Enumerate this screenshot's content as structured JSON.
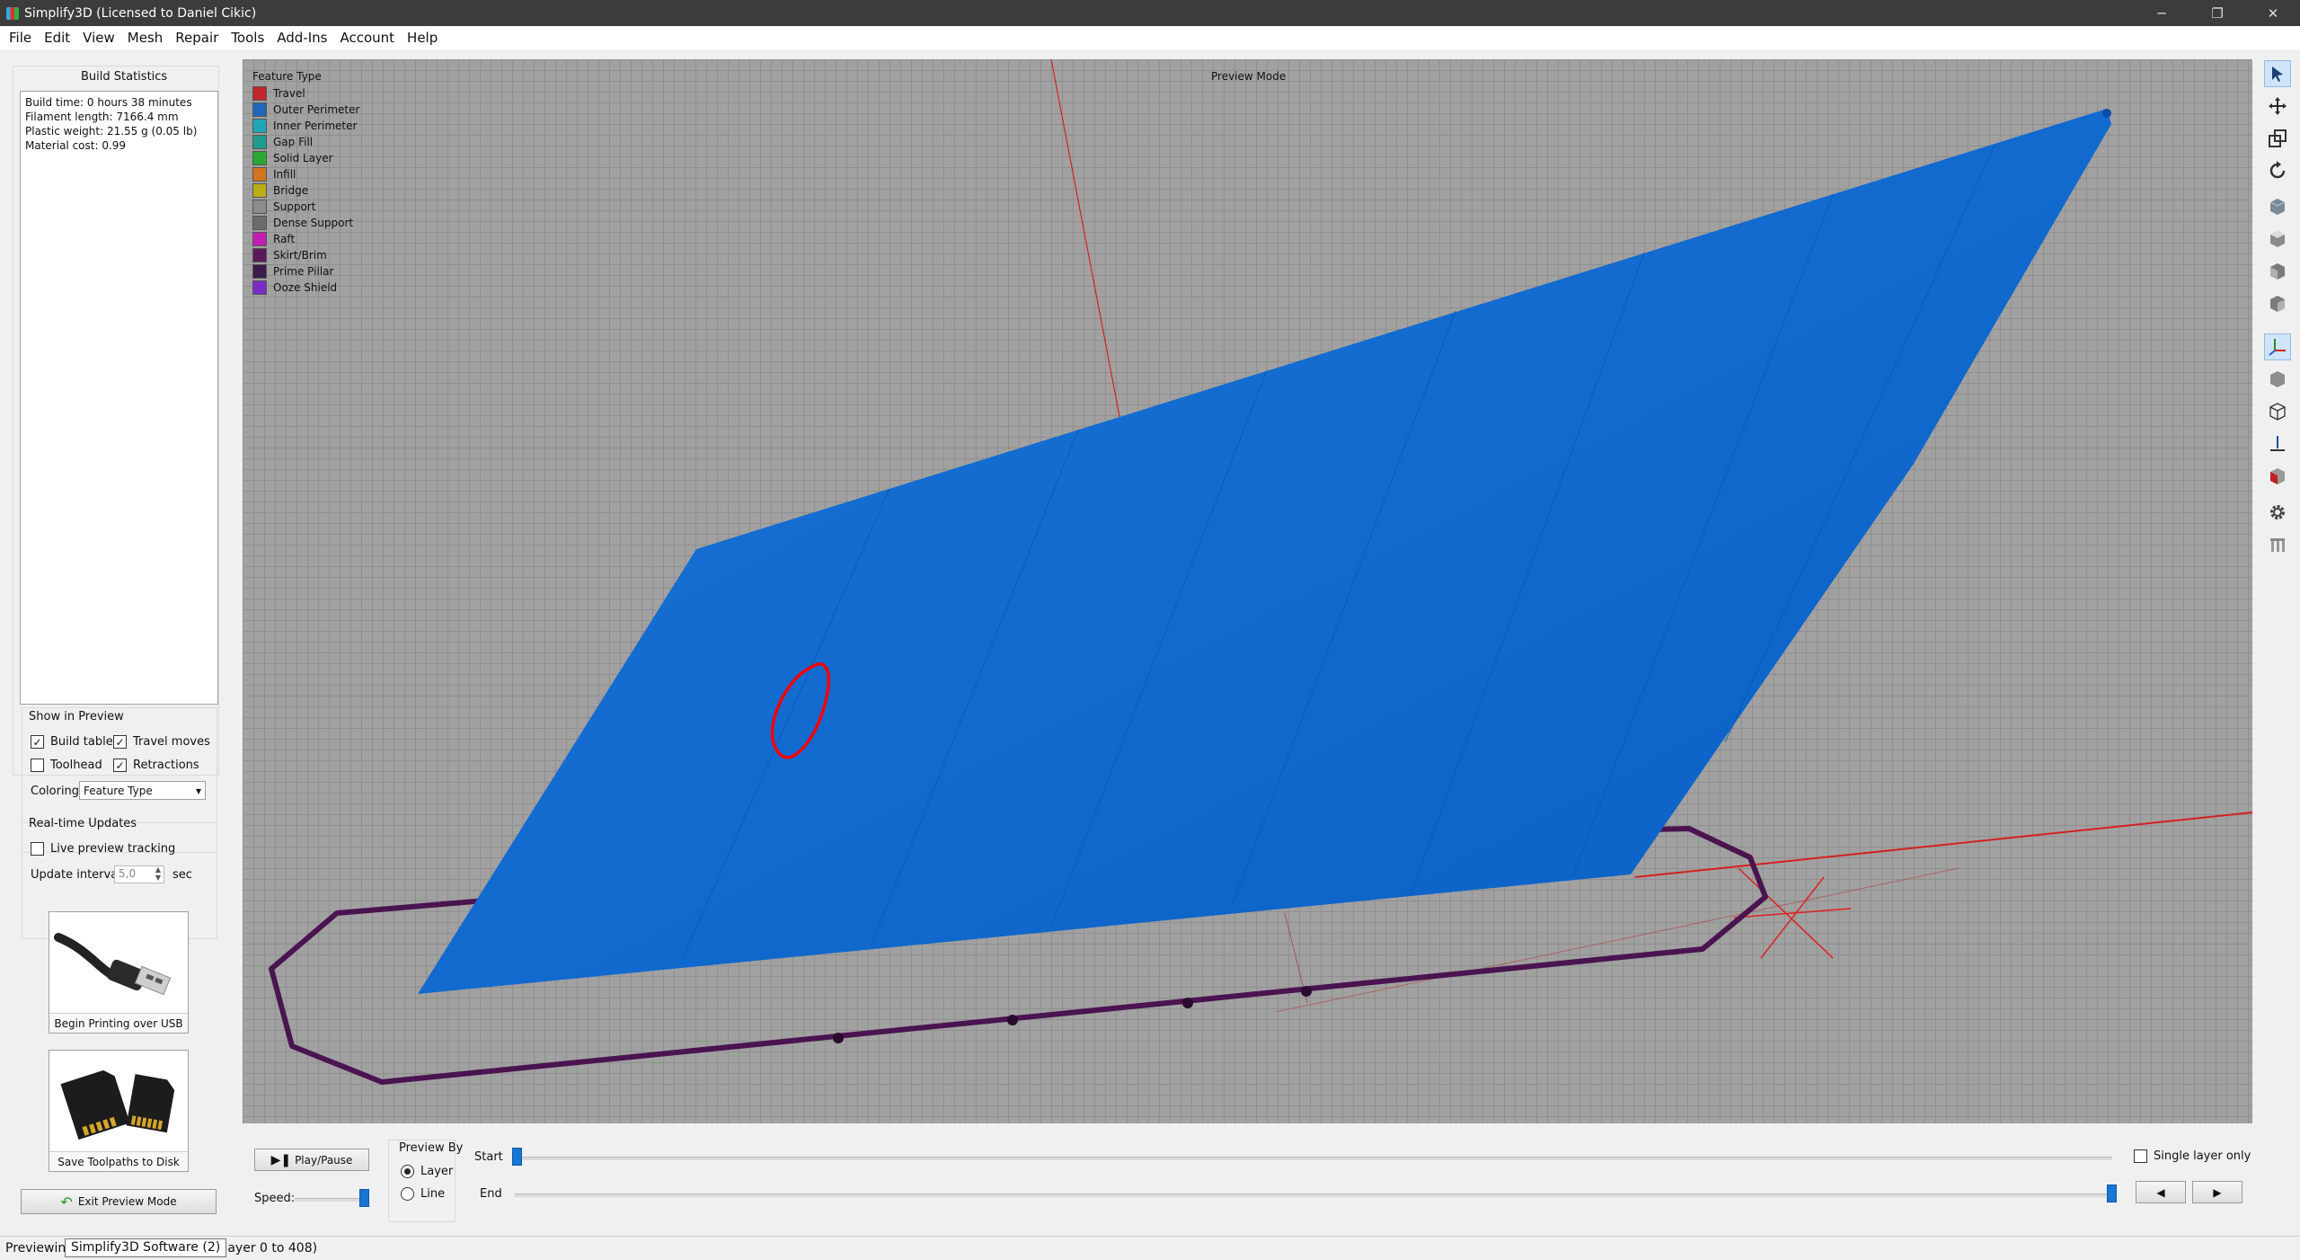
{
  "window": {
    "title": "Simplify3D (Licensed to Daniel Cikic)",
    "minimize": "─",
    "restore": "❐",
    "close": "✕"
  },
  "menu": [
    "File",
    "Edit",
    "View",
    "Mesh",
    "Repair",
    "Tools",
    "Add-Ins",
    "Account",
    "Help"
  ],
  "build_statistics": {
    "title": "Build Statistics",
    "lines": [
      "Build time: 0 hours 38 minutes",
      "Filament length: 7166.4 mm",
      "Plastic weight: 21.55 g (0.05 lb)",
      "Material cost: 0.99"
    ]
  },
  "show_in_preview": {
    "title": "Show in Preview",
    "build_table": {
      "label": "Build table",
      "checked": true
    },
    "travel_moves": {
      "label": "Travel moves",
      "checked": true
    },
    "toolhead": {
      "label": "Toolhead",
      "checked": false
    },
    "retractions": {
      "label": "Retractions",
      "checked": true
    },
    "coloring_label": "Coloring",
    "coloring_value": "Feature Type"
  },
  "realtime": {
    "title": "Real-time Updates",
    "live_tracking": {
      "label": "Live preview tracking",
      "checked": false
    },
    "interval_label": "Update interval",
    "interval_value": "5,0",
    "interval_unit": "sec"
  },
  "actions": {
    "usb_label": "Begin Printing over USB",
    "sd_label": "Save Toolpaths to Disk",
    "exit_label": "Exit Preview Mode"
  },
  "viewport": {
    "mode_label": "Preview Mode",
    "legend_title": "Feature Type",
    "legend": [
      {
        "name": "Travel",
        "color": "#c0262a"
      },
      {
        "name": "Outer Perimeter",
        "color": "#2166b8"
      },
      {
        "name": "Inner Perimeter",
        "color": "#1fa5b8"
      },
      {
        "name": "Gap Fill",
        "color": "#1e9c8e"
      },
      {
        "name": "Solid Layer",
        "color": "#2aa832"
      },
      {
        "name": "Infill",
        "color": "#d3751e"
      },
      {
        "name": "Bridge",
        "color": "#b8ae16"
      },
      {
        "name": "Support",
        "color": "#8c8c8c"
      },
      {
        "name": "Dense Support",
        "color": "#6c6c6c"
      },
      {
        "name": "Raft",
        "color": "#c21fb0"
      },
      {
        "name": "Skirt/Brim",
        "color": "#5a1a5a"
      },
      {
        "name": "Prime Pillar",
        "color": "#3b1c4a"
      },
      {
        "name": "Ooze Shield",
        "color": "#7a2cc4"
      }
    ]
  },
  "bottom": {
    "play_label": "Play/Pause",
    "speed_label": "Speed:",
    "preview_by_title": "Preview By",
    "layer_label": "Layer",
    "line_label": "Line",
    "start_label": "Start",
    "end_label": "End",
    "single_layer_label": "Single layer only",
    "preview_by_selected": "Layer"
  },
  "status": {
    "left": "Previewin",
    "tooltip": "Simplify3D Software (2)",
    "right": "(layer 0 to 408)"
  },
  "accent_color": "#1976d2",
  "model_color": "#0d6ad2"
}
